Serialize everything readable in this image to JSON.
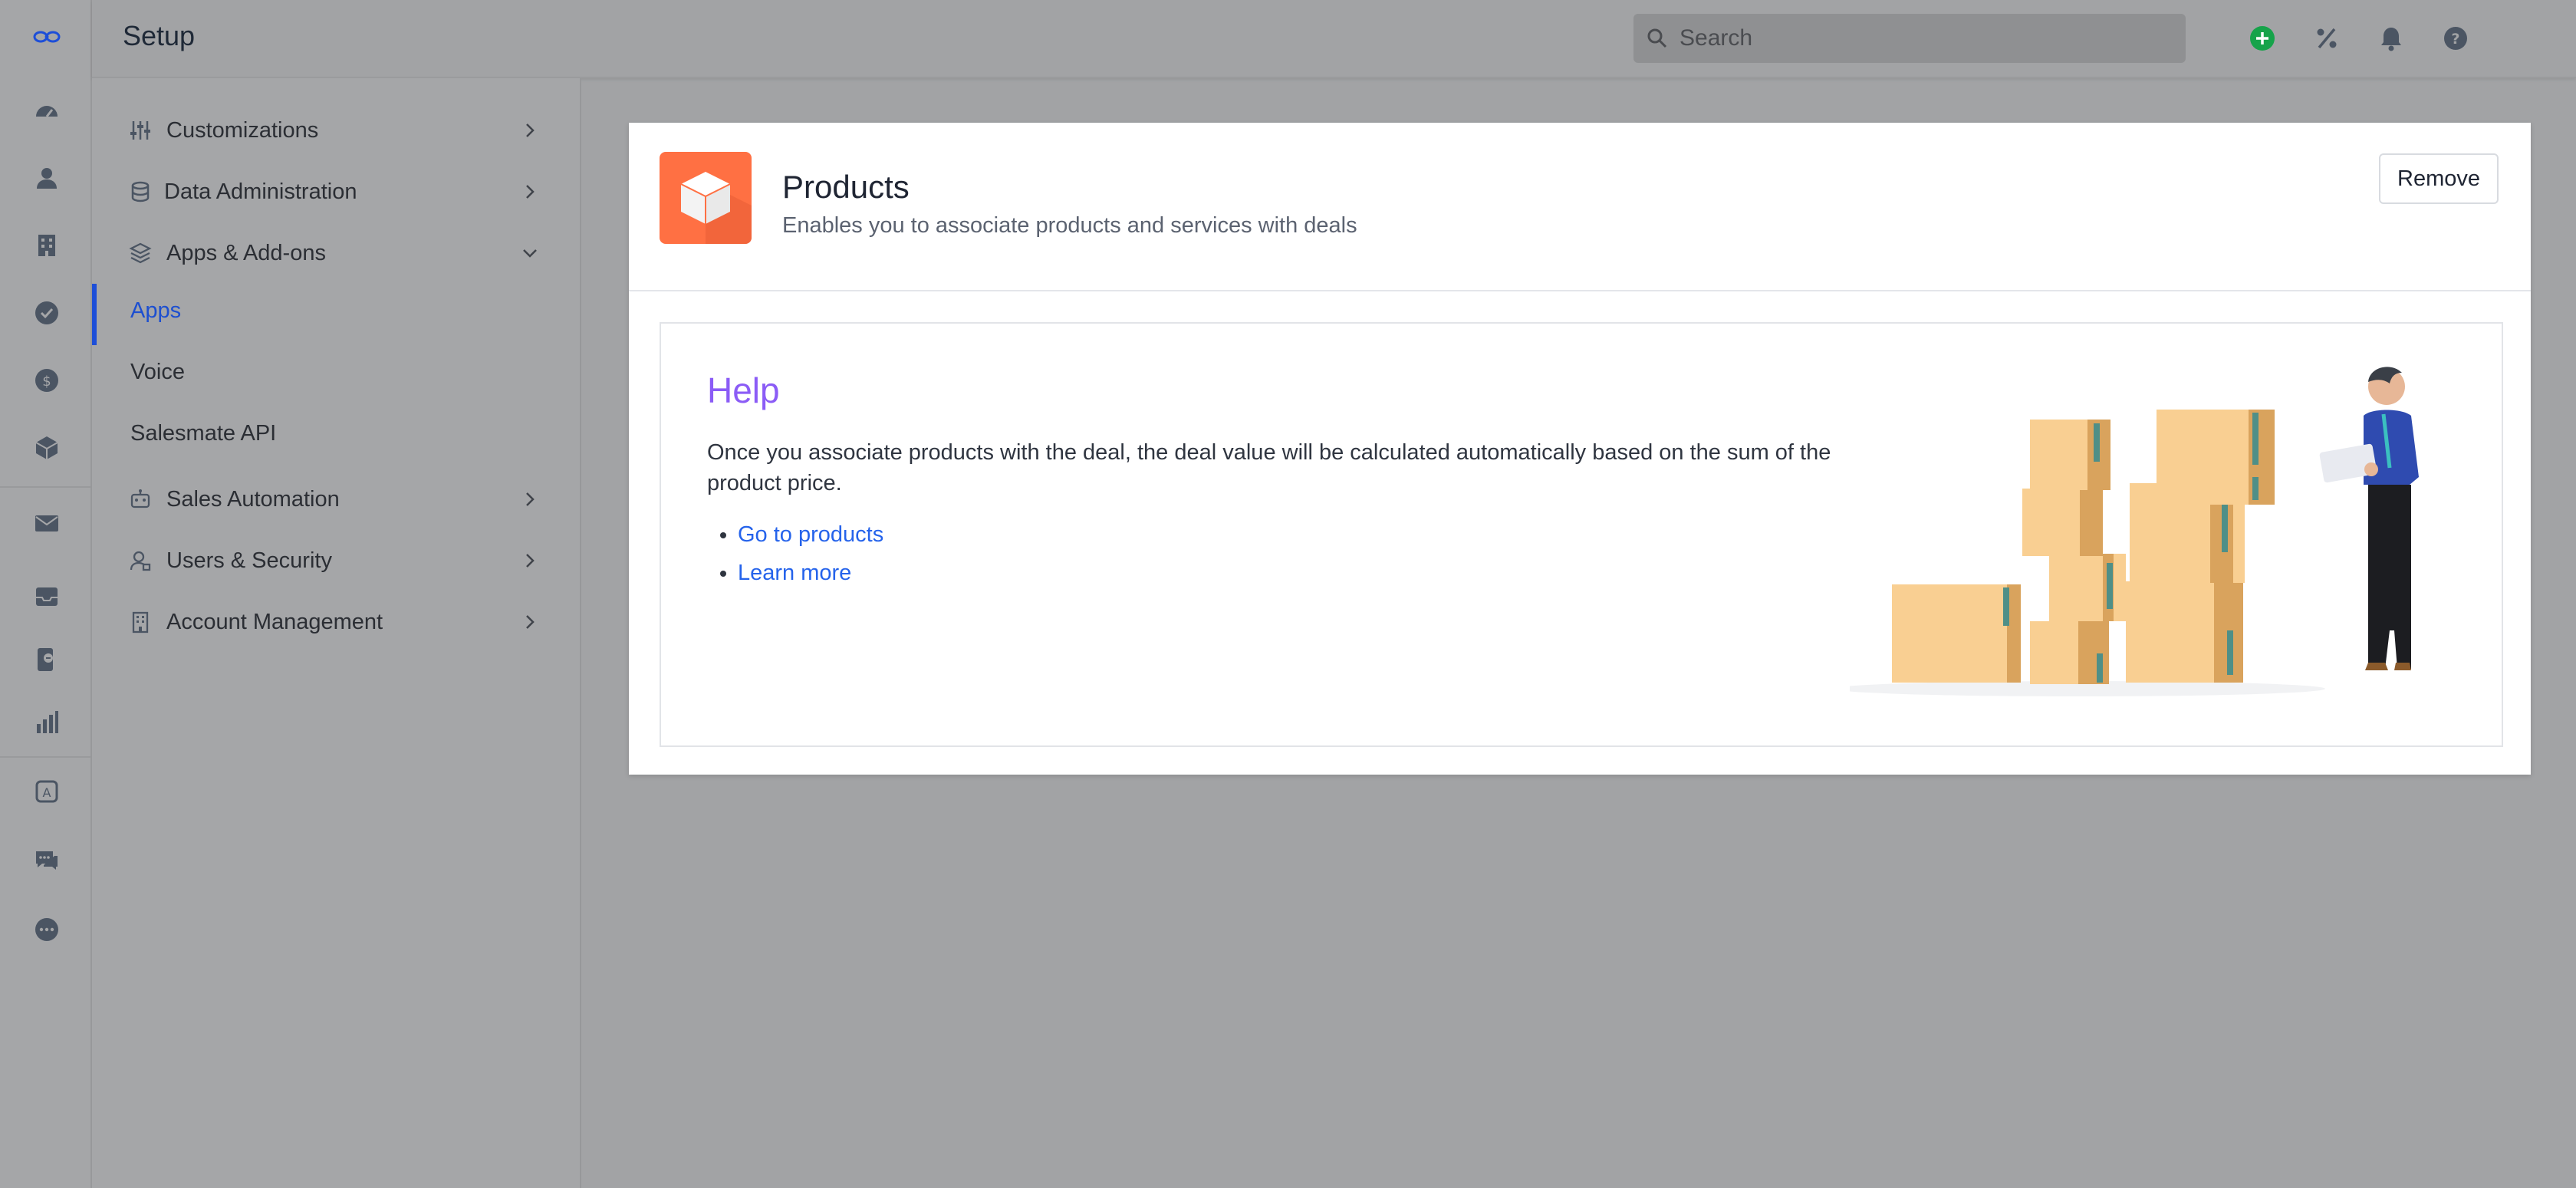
{
  "header": {
    "title": "Setup",
    "search_placeholder": "Search"
  },
  "icons": {
    "brand": "logo-icon",
    "rail": [
      "dashboard-icon",
      "contacts-icon",
      "companies-icon",
      "tasks-icon",
      "deals-icon",
      "products-icon",
      "email-icon",
      "inbox-icon",
      "calls-icon",
      "reports-icon",
      "automation-icon",
      "chat-icon",
      "more-icon"
    ],
    "header": [
      "add-icon",
      "percent-icon",
      "bell-icon",
      "help-icon"
    ]
  },
  "colors": {
    "accent": "#1d4ed8",
    "product_icon": "#ff7043",
    "help_title": "#8b5cf6",
    "link": "#2563eb",
    "add_button": "#16a34a"
  },
  "sidebar": {
    "items": [
      {
        "label": "Customizations"
      },
      {
        "label": "Data Administration"
      },
      {
        "label": "Apps & Add-ons"
      },
      {
        "label": "Apps"
      },
      {
        "label": "Voice"
      },
      {
        "label": "Salesmate API"
      },
      {
        "label": "Sales Automation"
      },
      {
        "label": "Users & Security"
      },
      {
        "label": "Account Management"
      }
    ]
  },
  "app": {
    "name": "Products",
    "description": "Enables you to associate products and services with deals",
    "remove_label": "Remove"
  },
  "help": {
    "title": "Help",
    "text": "Once you associate products with the deal, the deal value will be calculated automatically based on the sum of the product price.",
    "links": [
      "Go to products",
      "Learn more"
    ]
  }
}
